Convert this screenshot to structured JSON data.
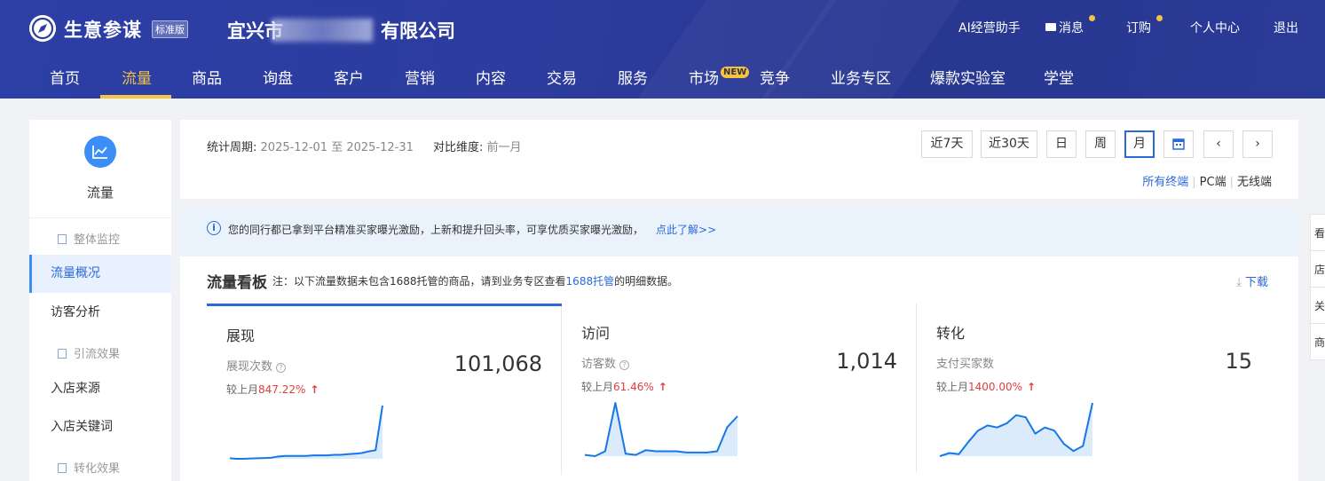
{
  "header": {
    "brand": "生意参谋",
    "edition": "标准版",
    "company_prefix": "宜兴市",
    "company_suffix": "有限公司",
    "top_links": [
      {
        "label": "AI经营助手"
      },
      {
        "label": "消息",
        "has_dot": true
      },
      {
        "label": "订购",
        "has_dot": true
      },
      {
        "label": "个人中心"
      },
      {
        "label": "退出"
      }
    ],
    "accent_color": "#f5c342",
    "main_nav": [
      "首页",
      "流量",
      "商品",
      "询盘",
      "客户",
      "营销",
      "内容",
      "交易",
      "服务",
      "市场",
      "竞争",
      "业务专区",
      "爆款实验室",
      "学堂"
    ],
    "main_nav_active": "流量",
    "new_badge": "NEW"
  },
  "sidebar": {
    "title": "流量",
    "groups": [
      {
        "label": "整体监控"
      },
      {
        "label": "引流效果"
      },
      {
        "label": "转化效果"
      }
    ],
    "items": [
      {
        "label": "流量概况",
        "active": true
      },
      {
        "label": "访客分析"
      },
      {
        "label": "入店来源"
      },
      {
        "label": "入店关键词"
      }
    ]
  },
  "filter": {
    "period_label": "统计周期:",
    "period_value": "2025-12-01 至 2025-12-31",
    "compare_label": "对比维度:",
    "compare_value": "前一月",
    "buttons": [
      "近7天",
      "近30天",
      "日",
      "周",
      "月"
    ],
    "active_button": "月",
    "terminals": [
      "所有终端",
      "PC端",
      "无线端"
    ],
    "active_terminal": "所有终端"
  },
  "notice": {
    "icon": "info-icon",
    "text": "您的同行都已拿到平台精准买家曝光激励，上新和提升回头率，可享优质买家曝光激励，",
    "link": "点此了解>>"
  },
  "board": {
    "title": "流量看板",
    "note_prefix": "注：以下流量数据未包含1688托管的商品，请到业务专区查看",
    "note_highlight": "1688托管",
    "note_suffix": "的明细数据。",
    "download": "下载",
    "metrics": [
      {
        "name": "展现",
        "sub": "展现次数",
        "value": "101,068",
        "cmp_label": "较上月",
        "cmp_value": "847.22%",
        "has_help": true,
        "trend": [
          2,
          1.5,
          1.5,
          1.8,
          2,
          2.2,
          2.5,
          3.5,
          4,
          4,
          4,
          4,
          4.5,
          4.5,
          4.5,
          5,
          5,
          5.5,
          6,
          6.5,
          8,
          9,
          48
        ]
      },
      {
        "name": "访问",
        "sub": "访客数",
        "value": "1,014",
        "cmp_label": "较上月",
        "cmp_value": "61.46%",
        "has_help": true,
        "trend": [
          2,
          1,
          5,
          45,
          3,
          2,
          6,
          5,
          5,
          5,
          4,
          4,
          4,
          5,
          25,
          34
        ]
      },
      {
        "name": "转化",
        "sub": "支付买家数",
        "value": "15",
        "cmp_label": "较上月",
        "cmp_value": "1400.00%",
        "has_help": false,
        "trend": [
          0,
          3,
          2,
          14,
          25,
          30,
          28,
          32,
          40,
          38,
          22,
          28,
          25,
          12,
          5,
          10,
          52
        ]
      }
    ]
  },
  "float_tabs": [
    "看",
    "店",
    "关",
    "商"
  ]
}
